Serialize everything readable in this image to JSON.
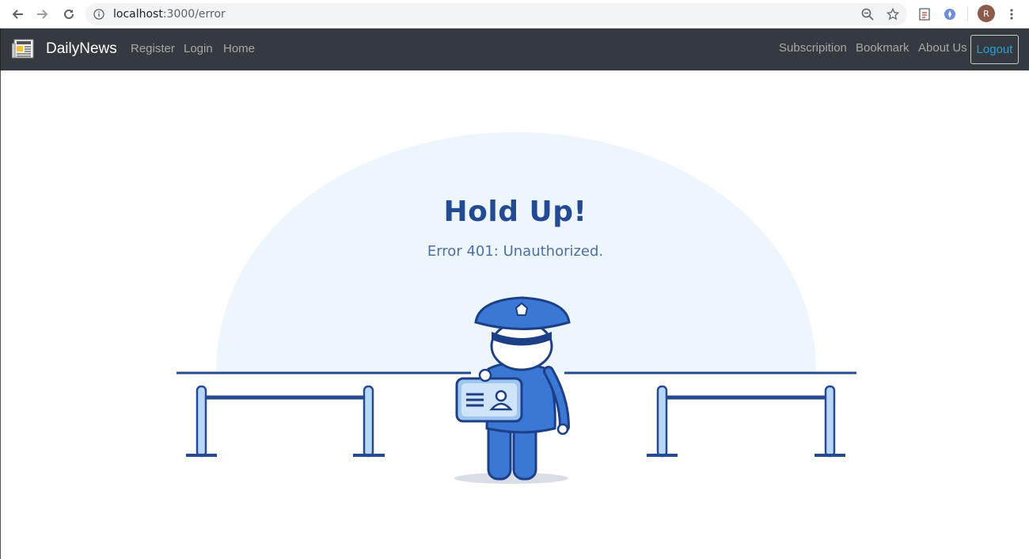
{
  "browser": {
    "url_host": "localhost",
    "url_path": ":3000/error",
    "avatar_initial": "R"
  },
  "navbar": {
    "brand": "DailyNews",
    "left_links": [
      "Register",
      "Login",
      "Home"
    ],
    "right_links": [
      "Subscripition",
      "Bookmark",
      "About Us"
    ],
    "logout": "Logout"
  },
  "error": {
    "title": "Hold Up!",
    "message": "Error 401: Unauthorized."
  },
  "colors": {
    "navbar_bg": "#343a40",
    "accent_blue": "#234a92",
    "logout_text": "#2a9fd6",
    "halo": "#eef6fd"
  }
}
